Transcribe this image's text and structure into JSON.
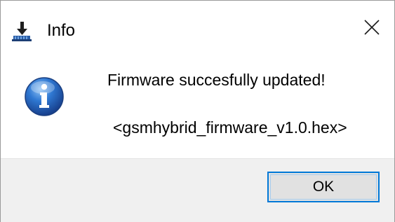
{
  "window": {
    "title": "Info",
    "app_icon": "flash-tool-icon",
    "close_icon": "close-icon"
  },
  "message": {
    "icon": "info-icon",
    "text": "Firmware succesfully updated!",
    "filename": "<gsmhybrid_firmware_v1.0.hex>"
  },
  "buttons": {
    "ok_label": "OK"
  },
  "colors": {
    "accent": "#0078d7",
    "footer_bg": "#f0f0f0",
    "button_bg": "#e1e1e1"
  }
}
